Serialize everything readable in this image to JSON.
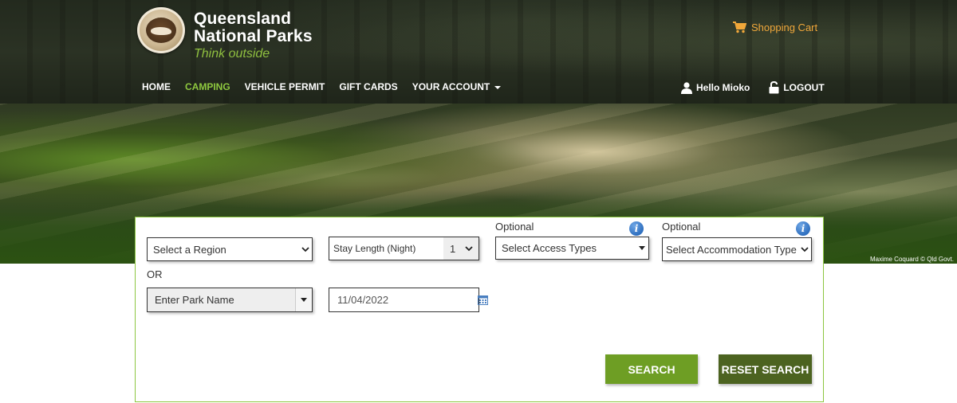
{
  "brand": {
    "name_line1": "Queensland",
    "name_line2": "National Parks",
    "tagline": "Think outside",
    "tagline_color": "#8fbf3f"
  },
  "cart": {
    "label": "Shopping Cart",
    "icon": "shopping-cart-icon",
    "color": "#f0a73a"
  },
  "nav": {
    "items": [
      {
        "label": "HOME",
        "active": false
      },
      {
        "label": "CAMPING",
        "active": true
      },
      {
        "label": "VEHICLE PERMIT",
        "active": false
      },
      {
        "label": "GIFT CARDS",
        "active": false
      },
      {
        "label": "YOUR ACCOUNT",
        "active": false,
        "dropdown": true
      }
    ],
    "active_color": "#8fc93f"
  },
  "user": {
    "greeting": "Hello Mioko",
    "user_icon": "user-icon",
    "logout_label": "LOGOUT",
    "logout_icon": "unlock-icon"
  },
  "hero": {
    "credit": "Maxime Coquard © Qld Govt."
  },
  "search": {
    "region": {
      "selected": "Select a Region"
    },
    "or_label": "OR",
    "park": {
      "placeholder": "Enter Park Name"
    },
    "stay_length": {
      "label": "Stay Length (Night)",
      "selected": "1"
    },
    "date": {
      "value": "11/04/2022",
      "icon": "calendar-icon"
    },
    "access": {
      "optional_label": "Optional",
      "selected": "Select Access Types",
      "info_icon": "info-icon"
    },
    "accommodation": {
      "optional_label": "Optional",
      "selected": "Select Accommodation Type",
      "info_icon": "info-icon"
    },
    "search_button": "SEARCH",
    "reset_button": "RESET SEARCH",
    "border_color": "#8cc63f",
    "search_button_color": "#6e9e24",
    "reset_button_color": "#4c6320"
  }
}
